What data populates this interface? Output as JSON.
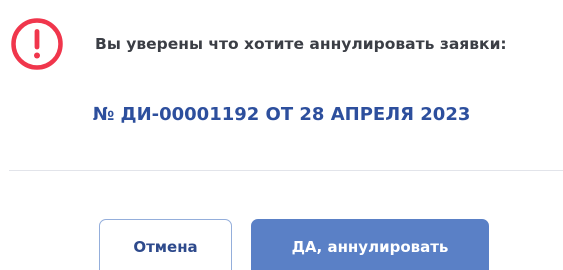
{
  "dialog": {
    "icon": "alert-circle-icon",
    "question": "Вы уверены что хотите аннулировать заявки:",
    "document_ref": "№ ДИ-00001192 ОТ 28 АПРЕЛЯ 2023",
    "buttons": {
      "cancel_label": "Отмена",
      "confirm_label": "ДА, аннулировать"
    }
  },
  "colors": {
    "alert": "#f0364c",
    "question_text": "#3b3e45",
    "document_ref": "#2d4f9d",
    "cancel_border": "#94aedb",
    "cancel_text": "#2e4a8c",
    "confirm_background": "#5a80c6",
    "confirm_text": "#ffffff",
    "divider": "#e2e4ea"
  }
}
